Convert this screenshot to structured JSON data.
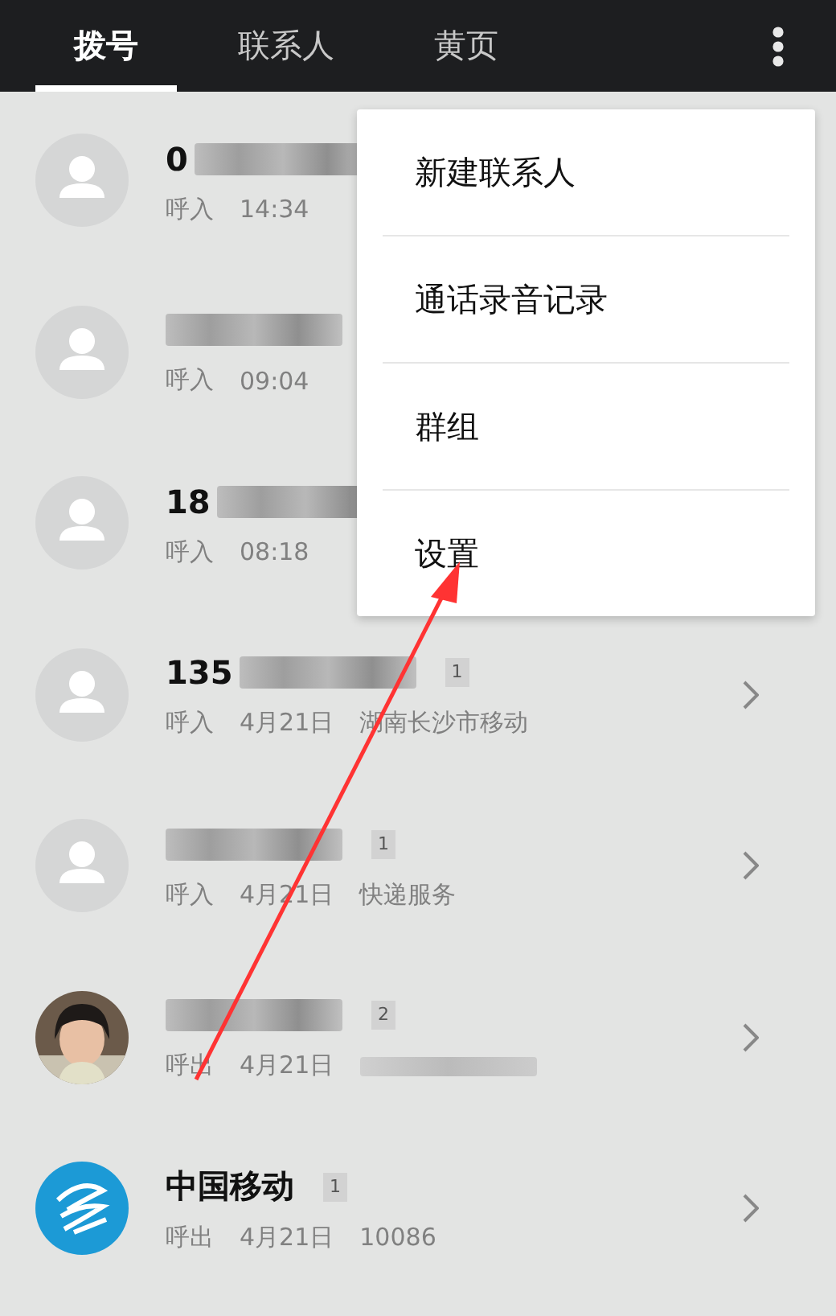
{
  "tabs": [
    {
      "label": "拨号",
      "selected": true
    },
    {
      "label": "联系人",
      "selected": false
    },
    {
      "label": "黄页",
      "selected": false
    }
  ],
  "calls": [
    {
      "kind": "default",
      "name": "0",
      "redacted": true,
      "direction": "呼入",
      "time": "14:34"
    },
    {
      "kind": "default",
      "redacted": true,
      "direction": "呼入",
      "time": "09:04"
    },
    {
      "kind": "default",
      "name": "18",
      "redacted": true,
      "direction": "呼入",
      "time": "08:18"
    },
    {
      "kind": "default",
      "name": "135",
      "redacted": true,
      "sim": "1",
      "direction": "呼入",
      "time": "4月21日",
      "location": "湖南长沙市移动",
      "chevron": true
    },
    {
      "kind": "default",
      "redacted": true,
      "sim": "1",
      "direction": "呼入",
      "time": "4月21日",
      "location": "快递服务",
      "chevron": true
    },
    {
      "kind": "picture",
      "redacted": true,
      "sim": "2",
      "direction": "呼出",
      "time": "4月21日",
      "location_redacted": true,
      "chevron": true
    },
    {
      "kind": "logo",
      "name": "中国移动",
      "redacted": false,
      "sim": "1",
      "direction": "呼出",
      "time": "4月21日",
      "location": "10086",
      "chevron": true
    }
  ],
  "menu": {
    "items": [
      "新建联系人",
      "通话录音记录",
      "群组",
      "设置"
    ]
  },
  "annotations": [
    {
      "kind": "arrow"
    }
  ]
}
